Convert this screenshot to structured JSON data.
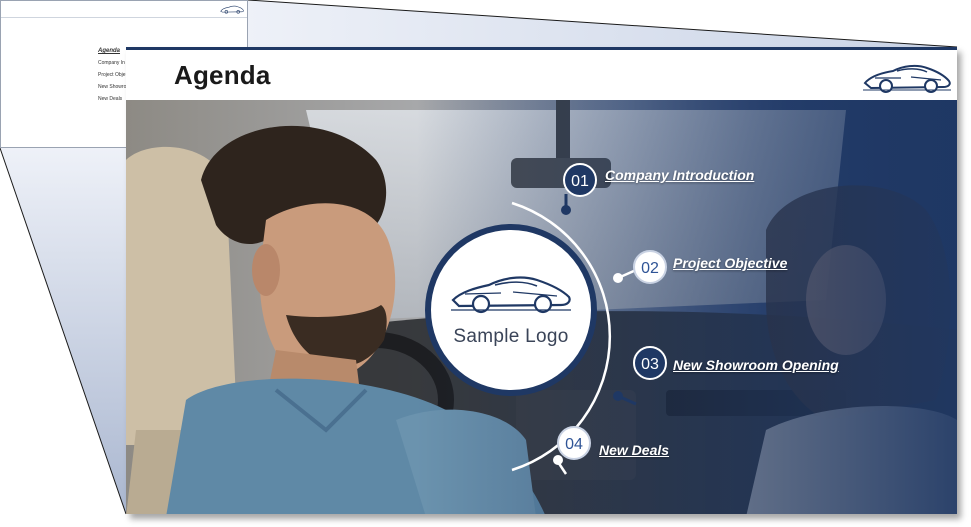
{
  "slide": {
    "title": "Agenda",
    "logo_text": "Sample Logo"
  },
  "thumbnail": {
    "title": "Agenda",
    "items": [
      "Company In",
      "Project Obje",
      "New Showro",
      "New Deals"
    ]
  },
  "agenda": [
    {
      "number": "01",
      "label": "Company Introduction",
      "style": "dark"
    },
    {
      "number": "02",
      "label": "Project Objective",
      "style": "light"
    },
    {
      "number": "03",
      "label": "New Showroom Opening",
      "style": "dark"
    },
    {
      "number": "04",
      "label": "New Deals",
      "style": "light"
    }
  ],
  "colors": {
    "navy": "#1f3864",
    "accent_blue": "#2f5496",
    "white": "#ffffff"
  },
  "icons": {
    "car_logo": "car-outline-icon"
  }
}
